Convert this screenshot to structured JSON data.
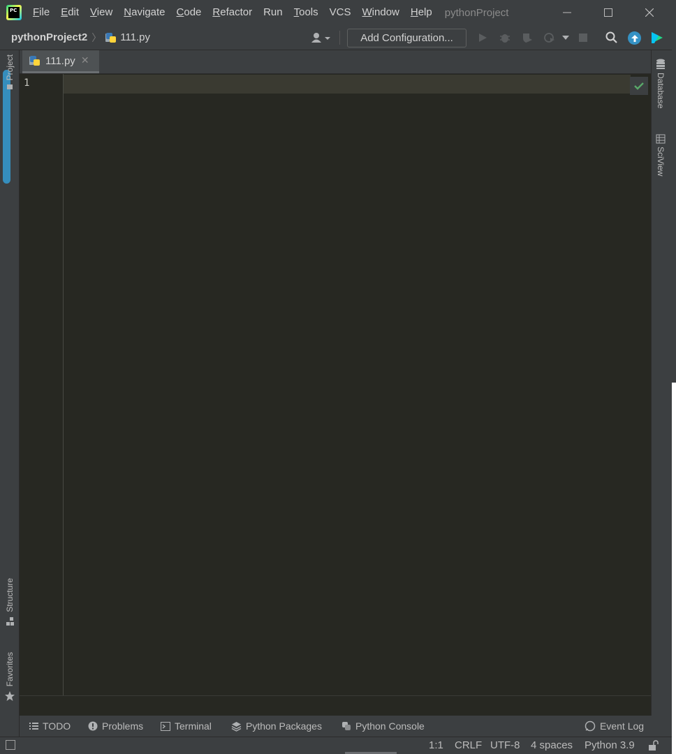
{
  "window": {
    "menu": [
      {
        "label": "File",
        "mnemonic": "F",
        "rest": "ile"
      },
      {
        "label": "Edit",
        "mnemonic": "E",
        "rest": "dit"
      },
      {
        "label": "View",
        "mnemonic": "V",
        "rest": "iew"
      },
      {
        "label": "Navigate",
        "mnemonic": "N",
        "rest": "avigate"
      },
      {
        "label": "Code",
        "mnemonic": "C",
        "rest": "ode"
      },
      {
        "label": "Refactor",
        "mnemonic": "R",
        "rest": "efactor"
      },
      {
        "label": "Run",
        "mnemonic": "",
        "rest": "Run"
      },
      {
        "label": "Tools",
        "mnemonic": "T",
        "rest": "ools"
      },
      {
        "label": "VCS",
        "mnemonic": "",
        "rest": "VCS"
      },
      {
        "label": "Window",
        "mnemonic": "W",
        "rest": "indow"
      },
      {
        "label": "Help",
        "mnemonic": "H",
        "rest": "elp"
      }
    ],
    "title": "pythonProject",
    "logo_text": "PC"
  },
  "navbar": {
    "project": "pythonProject2",
    "file": "111.py",
    "add_configuration": "Add Configuration..."
  },
  "left_strip": {
    "project": "Project",
    "structure": "Structure",
    "favorites": "Favorites"
  },
  "right_strip": {
    "database": "Database",
    "sciview": "SciView"
  },
  "tabs": [
    {
      "label": "111.py",
      "active": true
    }
  ],
  "editor": {
    "line_numbers": [
      "1"
    ]
  },
  "bottom_tools": {
    "todo": "TODO",
    "problems": "Problems",
    "terminal": "Terminal",
    "python_packages": "Python Packages",
    "python_console": "Python Console",
    "event_log": "Event Log"
  },
  "status": {
    "position": "1:1",
    "line_separator": "CRLF",
    "encoding": "UTF-8",
    "indent": "4 spaces",
    "interpreter": "Python 3.9"
  },
  "colors": {
    "editor_bg": "#272822",
    "chrome_bg": "#3c3f41",
    "accent": "#3592c4",
    "ok_green": "#59a869"
  }
}
